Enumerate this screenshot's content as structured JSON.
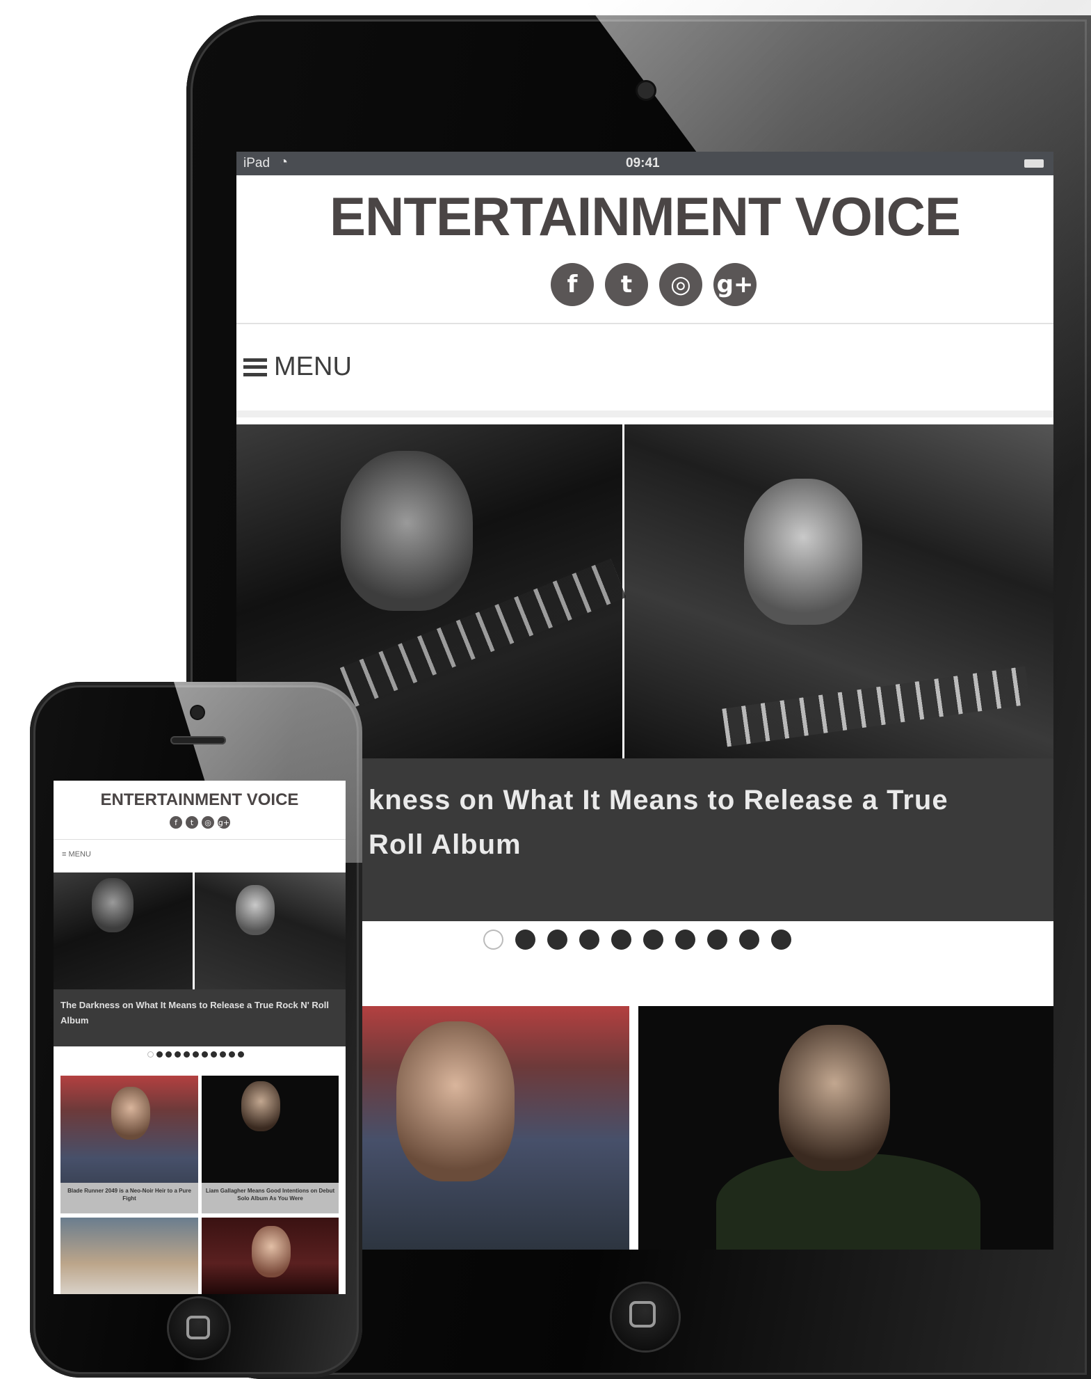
{
  "ipad": {
    "status": {
      "carrier": "iPad",
      "time": "09:41"
    },
    "site_title": "ENTERTAINMENT VOICE",
    "social": [
      {
        "icon": "facebook-icon",
        "glyph": "f"
      },
      {
        "icon": "twitter-icon",
        "glyph": "t"
      },
      {
        "icon": "instagram-icon",
        "glyph": "◎"
      },
      {
        "icon": "google-plus-icon",
        "glyph": "g+"
      }
    ],
    "menu_label": "MENU",
    "caption_line1": "kness on What It Means to Release a True",
    "caption_line2": "Roll Album",
    "slider_dot_count": 10,
    "active_dot": 0
  },
  "iphone": {
    "site_title": "ENTERTAINMENT VOICE",
    "menu_label": "≡ MENU",
    "caption": "The Darkness on What It Means to Release a True Rock N' Roll Album",
    "thumb1_caption": "Blade Runner 2049 is a Neo-Noir Heir to a Pure Fight",
    "thumb2_caption": "Liam Gallagher Means Good Intentions on Debut Solo Album As You Were"
  },
  "colors": {
    "title": "#4a4545",
    "caption_bg": "#3a3a3a",
    "status_bar": "#4a4d52"
  }
}
